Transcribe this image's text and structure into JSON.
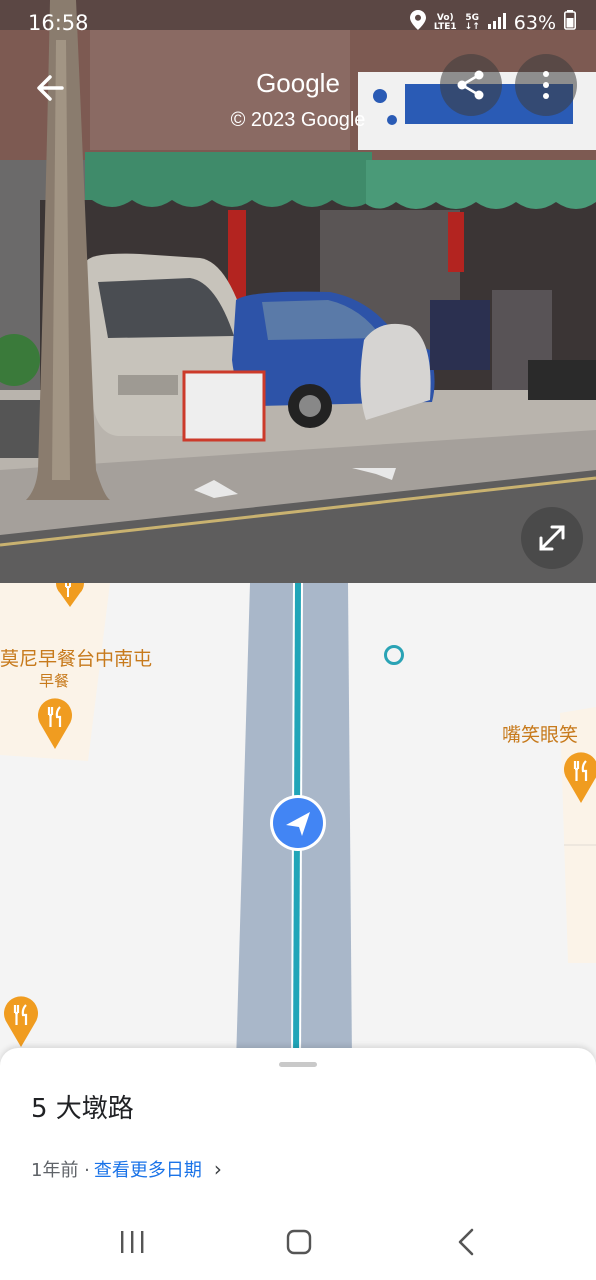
{
  "status_bar": {
    "time": "16:58",
    "network_top": "Vo)",
    "network_bottom": "LTE1",
    "network_type": "5G",
    "battery": "63%"
  },
  "street_view": {
    "title": "Google",
    "copyright": "© 2023 Google",
    "icons": {
      "back": "back-arrow-icon",
      "share": "share-icon",
      "more": "more-vert-icon",
      "expand": "expand-icon"
    }
  },
  "map": {
    "poi_left_name": "莫尼早餐台中南屯",
    "poi_left_category": "早餐",
    "poi_right_name": "嘴笑眼笑",
    "accent_blue": "#4285f4",
    "route_teal": "#21a5b8",
    "poi_color": "#f09c20"
  },
  "sheet": {
    "place_name": "5 大墩路",
    "date_text": "1年前 · ",
    "more_dates_link": "查看更多日期",
    "chevron": "›"
  },
  "navbar": {
    "recent": "recent-apps-icon",
    "home": "home-icon",
    "back": "nav-back-icon"
  }
}
